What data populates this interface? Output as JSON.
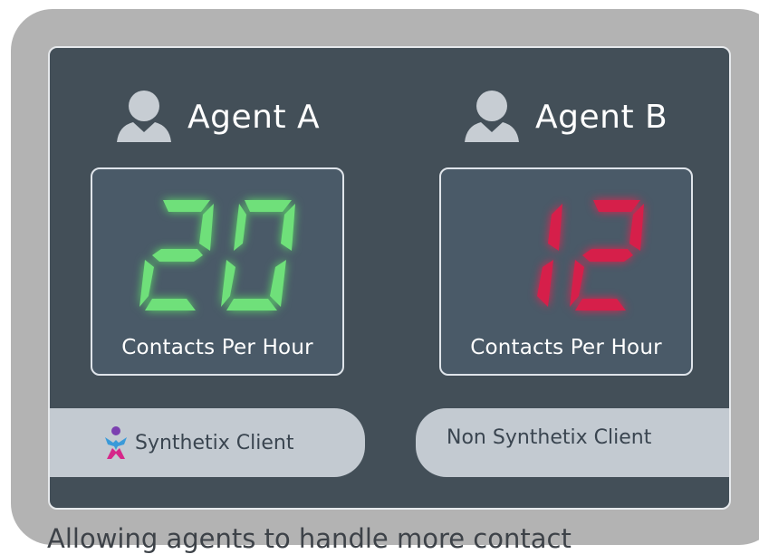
{
  "agents": [
    {
      "name": "Agent A",
      "value": "20",
      "label": "Contacts Per Hour",
      "digit_color": "#6fe07a",
      "glow_color": "#5cd96a"
    },
    {
      "name": "Agent B",
      "value": "12",
      "label": "Contacts Per Hour",
      "digit_color": "#d61f4a",
      "glow_color": "#e0234f"
    }
  ],
  "clients": {
    "left": "Synthetix Client",
    "right": "Non Synthetix Client"
  },
  "caption": "Allowing agents to handle more contact",
  "icons": {
    "agent": "person-icon",
    "logo": "synthetix-logo-icon"
  }
}
